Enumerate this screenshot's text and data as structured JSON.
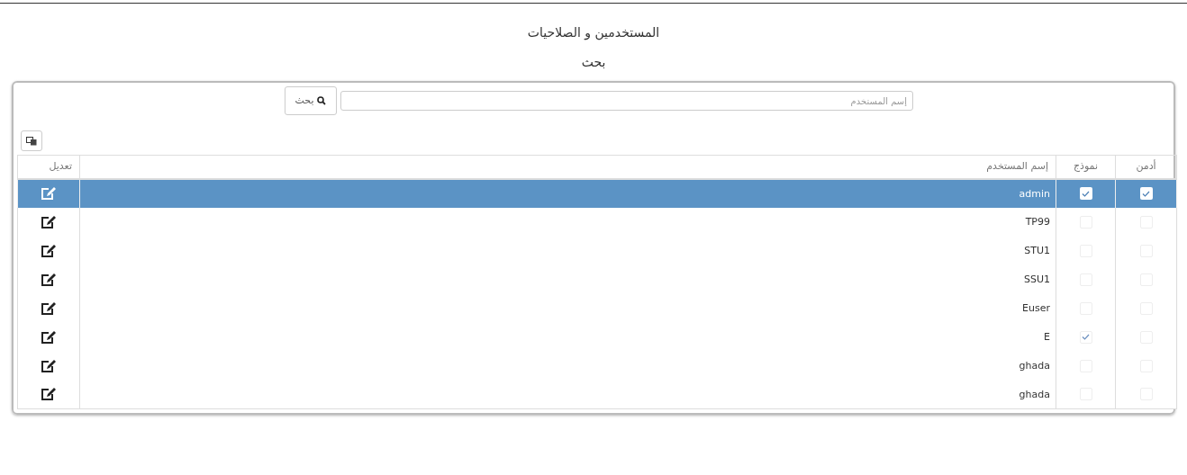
{
  "title": "المستخدمين و الصلاحيات",
  "subtitle": "بحث",
  "search": {
    "placeholder": "إسم المستخدم",
    "button_label": "بحث"
  },
  "table": {
    "columns": [
      "أدمن",
      "نموذج",
      "إسم المستخدم",
      "تعديل"
    ],
    "rows": [
      {
        "admin": true,
        "form": true,
        "username": "admin",
        "selected": true
      },
      {
        "admin": false,
        "form": false,
        "username": "TP99",
        "selected": false
      },
      {
        "admin": false,
        "form": false,
        "username": "STU1",
        "selected": false
      },
      {
        "admin": false,
        "form": false,
        "username": "SSU1",
        "selected": false
      },
      {
        "admin": false,
        "form": false,
        "username": "Euser",
        "selected": false
      },
      {
        "admin": false,
        "form": true,
        "username": "E",
        "selected": false
      },
      {
        "admin": false,
        "form": false,
        "username": "ghada",
        "selected": false
      },
      {
        "admin": false,
        "form": false,
        "username": "ghada",
        "selected": false
      }
    ]
  }
}
